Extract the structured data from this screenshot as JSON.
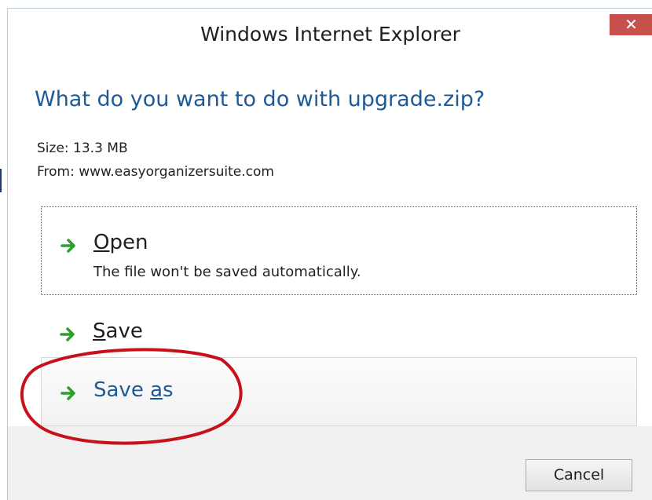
{
  "window": {
    "title": "Windows Internet Explorer",
    "close_glyph": "✕"
  },
  "prompt": {
    "heading": "What do you want to do with upgrade.zip?",
    "size_line": "Size: 13.3 MB",
    "from_line": "From: www.easyorganizersuite.com"
  },
  "options": {
    "open": {
      "label": "Open",
      "subtitle": "The file won't be saved automatically."
    },
    "save": {
      "label": "Save"
    },
    "save_as": {
      "label": "Save as"
    }
  },
  "footer": {
    "cancel_label": "Cancel"
  },
  "colors": {
    "heading_blue": "#1e5a96",
    "arrow_green": "#2e9e2e",
    "close_red": "#c7504c",
    "annotation_red": "#c8101a"
  },
  "icons": {
    "option_arrow": "green-right-arrow-icon",
    "close": "close-icon"
  }
}
